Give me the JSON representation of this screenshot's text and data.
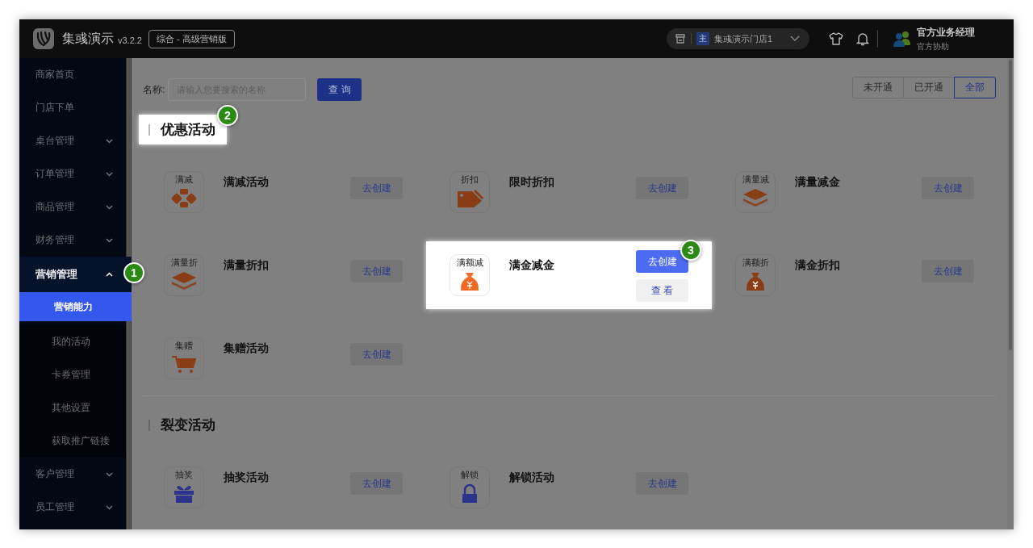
{
  "topbar": {
    "brand": "集彧演示",
    "version": "v3.2.2",
    "edition": "综合 - 高级营销版",
    "store_badge": "主",
    "store": "集彧演示门店1",
    "user_name": "官方业务经理",
    "user_role": "官方协助"
  },
  "sidebar": [
    {
      "label": "商家首页",
      "kind": "link"
    },
    {
      "label": "门店下单",
      "kind": "link"
    },
    {
      "label": "桌台管理",
      "kind": "group",
      "expanded": false
    },
    {
      "label": "订单管理",
      "kind": "group",
      "expanded": false
    },
    {
      "label": "商品管理",
      "kind": "group",
      "expanded": false
    },
    {
      "label": "财务管理",
      "kind": "group",
      "expanded": false
    },
    {
      "label": "营销管理",
      "kind": "group",
      "expanded": true,
      "callout": "1",
      "children": [
        {
          "label": "营销能力",
          "selected": true
        },
        {
          "label": "我的活动",
          "selected": false
        },
        {
          "label": "卡券管理",
          "selected": false
        },
        {
          "label": "其他设置",
          "selected": false
        },
        {
          "label": "获取推广链接",
          "selected": false
        }
      ]
    },
    {
      "label": "客户管理",
      "kind": "group",
      "expanded": false
    },
    {
      "label": "员工管理",
      "kind": "group",
      "expanded": false
    }
  ],
  "search": {
    "label": "名称:",
    "placeholder": "请输入您要搜索的名称",
    "button": "查 询"
  },
  "filters": [
    {
      "label": "未开通",
      "selected": false
    },
    {
      "label": "已开通",
      "selected": false
    },
    {
      "label": "全部",
      "selected": true
    }
  ],
  "sections": [
    {
      "title": "优惠活动",
      "highlighted": true,
      "callout": "2",
      "items": [
        {
          "icon_label": "满减",
          "name": "满减活动",
          "button": "去创建",
          "highlighted": false
        },
        {
          "icon_label": "折扣",
          "name": "限时折扣",
          "button": "去创建",
          "highlighted": false
        },
        {
          "icon_label": "满量减",
          "name": "满量减金",
          "button": "去创建",
          "highlighted": false
        },
        {
          "icon_label": "满量折",
          "name": "满量折扣",
          "button": "去创建",
          "highlighted": false
        },
        {
          "icon_label": "满额减",
          "name": "满金减金",
          "button": "去创建",
          "highlighted": true,
          "view_button": "查 看",
          "callout": "3"
        },
        {
          "icon_label": "满额折",
          "name": "满金折扣",
          "button": "去创建",
          "highlighted": false
        },
        {
          "icon_label": "集赠",
          "name": "集赠活动",
          "button": "去创建",
          "highlighted": false
        }
      ]
    },
    {
      "title": "裂变活动",
      "highlighted": false,
      "items": [
        {
          "icon_label": "抽奖",
          "name": "抽奖活动",
          "button": "去创建",
          "highlighted": false
        },
        {
          "icon_label": "解锁",
          "name": "解锁活动",
          "button": "去创建",
          "highlighted": false
        }
      ]
    }
  ]
}
